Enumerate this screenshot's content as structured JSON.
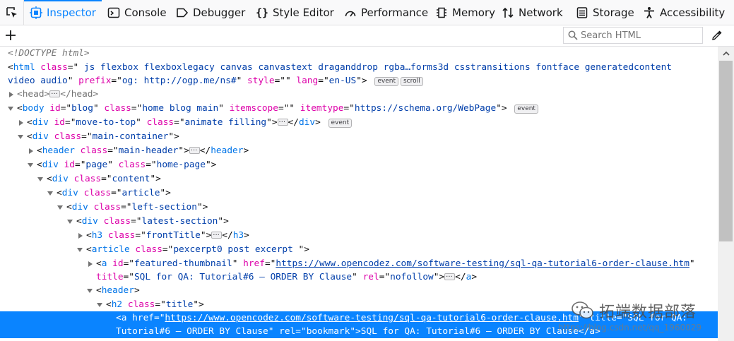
{
  "tabs": [
    {
      "label": "Inspector",
      "icon": "inspector-icon",
      "selected": true
    },
    {
      "label": "Console",
      "icon": "console-icon",
      "selected": false
    },
    {
      "label": "Debugger",
      "icon": "debugger-icon",
      "selected": false
    },
    {
      "label": "Style Editor",
      "icon": "style-editor-icon",
      "selected": false
    },
    {
      "label": "Performance",
      "icon": "performance-icon",
      "selected": false
    },
    {
      "label": "Memory",
      "icon": "memory-icon",
      "selected": false
    },
    {
      "label": "Network",
      "icon": "network-icon",
      "selected": false
    },
    {
      "label": "Storage",
      "icon": "storage-icon",
      "selected": false
    },
    {
      "label": "Accessibility",
      "icon": "accessibility-icon",
      "selected": false
    }
  ],
  "toolbar": {
    "search_placeholder": "Search HTML"
  },
  "badges": {
    "event": "event",
    "scroll": "scroll"
  },
  "markup": {
    "doctype": "<!DOCTYPE html>",
    "html_tag": "html",
    "html_class_attr": "class",
    "html_class_val": " js flexbox flexboxlegacy canvas canvastext draganddrop rgba…forms3d csstransitions fontface generatedcontent",
    "html_class_val2": "video audio",
    "html_prefix_attr": "prefix",
    "html_prefix_val": "og: http://ogp.me/ns#",
    "html_style_attr": "style",
    "html_style_val": "",
    "html_lang_attr": "lang",
    "html_lang_val": "en-US",
    "head_tag": "head",
    "body_tag": "body",
    "body_id_val": "blog",
    "body_class_val": "home blog main",
    "body_itemscope_attr": "itemscope",
    "body_itemscope_val": "",
    "body_itemtype_attr": "itemtype",
    "body_itemtype_val": "https://schema.org/WebPage",
    "div_tag": "div",
    "id_attr": "id",
    "class_attr": "class",
    "move_id_val": "move-to-top",
    "move_class_val": "animate filling",
    "main_container_val": "main-container",
    "header_tag": "header",
    "main_header_val": "main-header",
    "page_id_val": "page",
    "home_page_val": "home-page",
    "content_val": "content",
    "article_class_val": "article",
    "left_section_val": "left-section",
    "latest_section_val": "latest-section",
    "h3_tag": "h3",
    "front_title_val": "frontTitle",
    "article_tag": "article",
    "excerpt_val": "pexcerpt0 post excerpt ",
    "a_tag": "a",
    "thumb_id_val": "featured-thumbnail",
    "href_attr": "href",
    "thumb_href_val": "https://www.opencodez.com/software-testing/sql-qa-tutorial6-order-clause.htm",
    "title_attr": "title",
    "thumb_title_val": "SQL for QA: Tutorial#6 – ORDER BY Clause",
    "rel_attr": "rel",
    "thumb_rel_val": "nofollow",
    "h2_tag": "h2",
    "title_class_val": "title",
    "sel_href_val": "https://www.opencodez.com/software-testing/sql-qa-tutorial6-order-clause.htm",
    "sel_title_val_1": "SQL for QA:",
    "sel_title_val_2": "Tutorial#6 – ORDER BY Clause",
    "sel_rel_val": "bookmark",
    "sel_text": "SQL for QA: Tutorial#6 – ORDER BY Clause"
  },
  "watermark": {
    "text": "拓端数据部落",
    "url": "https://blog.csdn.net/qq_1960029"
  },
  "colors": {
    "accent": "#0a84ff",
    "tag": "#0074e8",
    "attr": "#dd00a9",
    "value": "#003eaa"
  }
}
